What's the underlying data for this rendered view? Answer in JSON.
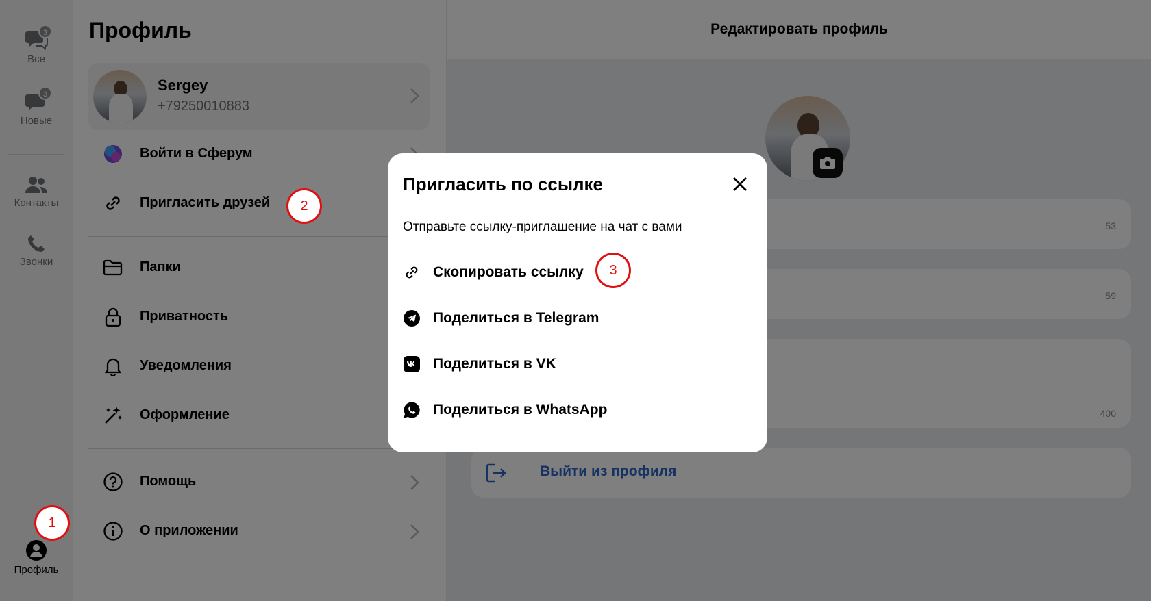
{
  "rail": {
    "all": {
      "label": "Все",
      "badge": "3"
    },
    "new": {
      "label": "Новые",
      "badge": "3"
    },
    "contacts": {
      "label": "Контакты"
    },
    "calls": {
      "label": "Звонки"
    },
    "profile": {
      "label": "Профиль"
    }
  },
  "profile": {
    "title": "Профиль",
    "user": {
      "name": "Sergey",
      "phone": "+79250010883"
    },
    "menu_top": [
      {
        "label": "Войти в Сферум",
        "icon": "spherum-logo-icon"
      },
      {
        "label": "Пригласить друзей",
        "icon": "link-icon"
      }
    ],
    "menu_mid": [
      {
        "label": "Папки",
        "icon": "folder-icon"
      },
      {
        "label": "Приватность",
        "icon": "lock-icon"
      },
      {
        "label": "Уведомления",
        "icon": "bell-icon"
      },
      {
        "label": "Оформление",
        "icon": "magic-wand-icon"
      }
    ],
    "menu_bottom": [
      {
        "label": "Помощь",
        "icon": "help-icon"
      },
      {
        "label": "О приложении",
        "icon": "info-icon"
      }
    ]
  },
  "edit": {
    "title": "Редактировать профиль",
    "counters": [
      "53",
      "59",
      "400"
    ],
    "logout_label": "Выйти из профиля"
  },
  "modal": {
    "title": "Пригласить по ссылке",
    "subtitle": "Отправьте ссылку-приглашение на чат с вами",
    "options": [
      {
        "label": "Скопировать ссылку",
        "icon": "link-icon"
      },
      {
        "label": "Поделиться в Telegram",
        "icon": "telegram-icon"
      },
      {
        "label": "Поделиться в VK",
        "icon": "vk-icon"
      },
      {
        "label": "Поделиться в WhatsApp",
        "icon": "whatsapp-icon"
      }
    ]
  },
  "steps": [
    "1",
    "2",
    "3"
  ],
  "colors": {
    "accent": "#2a64c5",
    "marker": "#e01010",
    "overlay": "rgba(0,0,0,0.5)"
  }
}
